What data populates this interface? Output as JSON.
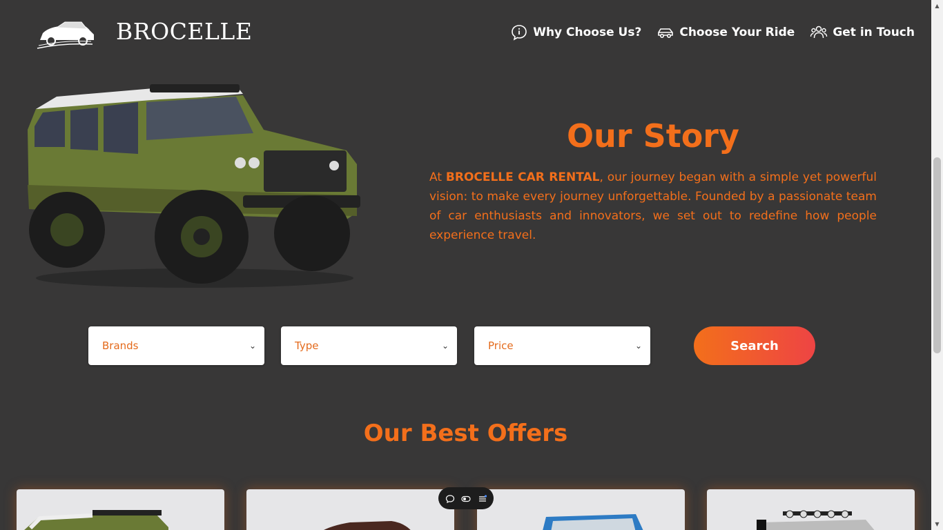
{
  "header": {
    "brand": "BROCELLE",
    "nav": [
      {
        "label": "Why Choose Us?",
        "icon": "info-chat-icon"
      },
      {
        "label": "Choose Your Ride",
        "icon": "car-icon"
      },
      {
        "label": "Get in Touch",
        "icon": "users-icon"
      }
    ]
  },
  "story": {
    "title": "Our Story",
    "text_prefix": "At ",
    "text_bold": "BROCELLE CAR RENTAL",
    "text_rest": ", our journey began with a simple yet powerful vision: to make every journey unforgettable. Founded by a passionate team of car enthusiasts and innovators, we set out to redefine how people experience travel."
  },
  "filters": {
    "brands": "Brands",
    "type": "Type",
    "price": "Price",
    "search": "Search"
  },
  "offers": {
    "title": "Our Best Offers"
  },
  "colors": {
    "accent": "#f36f1b",
    "background": "#383737",
    "gradient_end": "#ee4444"
  }
}
